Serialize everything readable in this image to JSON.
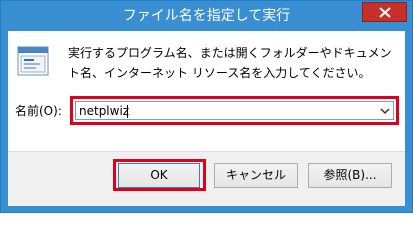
{
  "window": {
    "title": "ファイル名を指定して実行",
    "close_label": "×"
  },
  "dialog": {
    "description": "実行するプログラム名、または開くフォルダーやドキュメント名、インターネット リソース名を入力してください。",
    "open_label": "名前(O):",
    "open_value": "netplwiz"
  },
  "buttons": {
    "ok": "OK",
    "cancel": "キャンセル",
    "browse": "参照(B)..."
  },
  "colors": {
    "title_bar": "#3a8fd3",
    "close_button": "#c7302a",
    "highlight_border": "#e0001b"
  },
  "icons": {
    "app": "run-icon",
    "close": "close-icon",
    "dropdown": "chevron-down-icon"
  }
}
